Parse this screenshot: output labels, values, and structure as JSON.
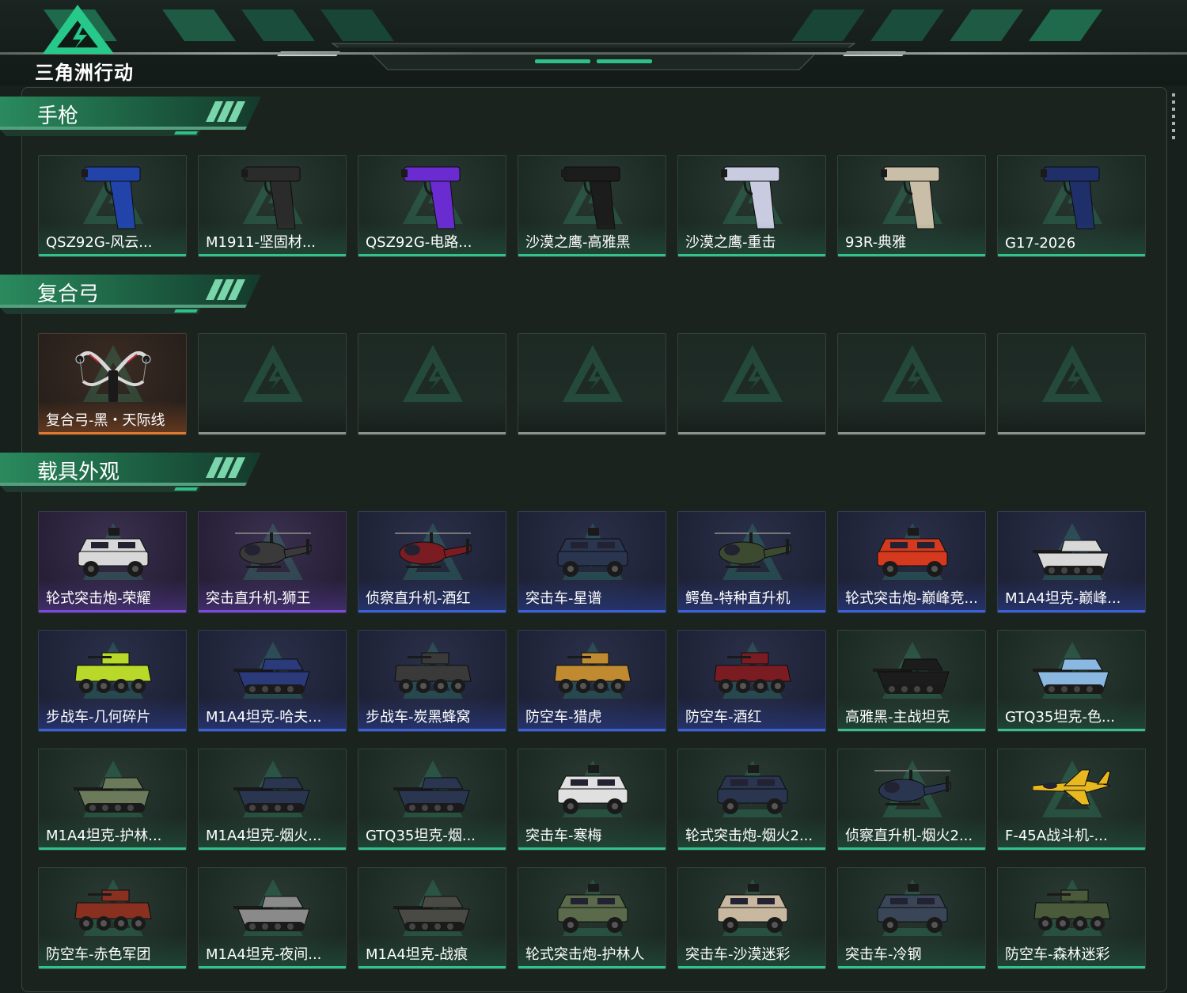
{
  "app": {
    "logo_text": "三角洲行动"
  },
  "sections": {
    "pistols": {
      "title": "手枪",
      "items": [
        {
          "label": "QSZ92G-风云...",
          "rarity": "green",
          "icon": "pistol-icon",
          "color": "#2244aa"
        },
        {
          "label": "M1911-坚固材...",
          "rarity": "green",
          "icon": "pistol-icon",
          "color": "#2b2b2b"
        },
        {
          "label": "QSZ92G-电路...",
          "rarity": "green",
          "icon": "pistol-icon",
          "color": "#6a2bd0"
        },
        {
          "label": "沙漠之鹰-高雅黑",
          "rarity": "green",
          "icon": "pistol-icon",
          "color": "#1c1c1c"
        },
        {
          "label": "沙漠之鹰-重击",
          "rarity": "green",
          "icon": "pistol-icon",
          "color": "#c9cbe0"
        },
        {
          "label": "93R-典雅",
          "rarity": "green",
          "icon": "pistol-icon",
          "color": "#c9bfa8"
        },
        {
          "label": "G17-2026",
          "rarity": "green",
          "icon": "pistol-icon",
          "color": "#1f2f6a"
        }
      ]
    },
    "bows": {
      "title": "复合弓",
      "items": [
        {
          "label": "复合弓-黑・天际线",
          "rarity": "orange",
          "icon": "bow-icon",
          "color": "#d8d8d8"
        },
        {
          "label": "",
          "rarity": "empty",
          "icon": "",
          "color": ""
        },
        {
          "label": "",
          "rarity": "empty",
          "icon": "",
          "color": ""
        },
        {
          "label": "",
          "rarity": "empty",
          "icon": "",
          "color": ""
        },
        {
          "label": "",
          "rarity": "empty",
          "icon": "",
          "color": ""
        },
        {
          "label": "",
          "rarity": "empty",
          "icon": "",
          "color": ""
        },
        {
          "label": "",
          "rarity": "empty",
          "icon": "",
          "color": ""
        }
      ]
    },
    "vehicles": {
      "title": "载具外观",
      "items": [
        {
          "label": "轮式突击炮-荣耀",
          "rarity": "purple",
          "icon": "armored-car-icon",
          "color": "#d8d8d8"
        },
        {
          "label": "突击直升机-狮王",
          "rarity": "purple",
          "icon": "helicopter-icon",
          "color": "#3a3a3a"
        },
        {
          "label": "侦察直升机-酒红",
          "rarity": "blue",
          "icon": "helicopter-icon",
          "color": "#7a1c22"
        },
        {
          "label": "突击车-星谱",
          "rarity": "blue",
          "icon": "armored-car-icon",
          "color": "#2a3550"
        },
        {
          "label": "鳄鱼-特种直升机",
          "rarity": "blue",
          "icon": "helicopter-icon",
          "color": "#3c4a30"
        },
        {
          "label": "轮式突击炮-巅峰竞...",
          "rarity": "blue",
          "icon": "armored-car-icon",
          "color": "#d63a1e"
        },
        {
          "label": "M1A4坦克-巅峰...",
          "rarity": "blue",
          "icon": "tank-icon",
          "color": "#d8d8d8"
        },
        {
          "label": "步战车-几何碎片",
          "rarity": "blue",
          "icon": "apc-icon",
          "color": "#b8d82a"
        },
        {
          "label": "M1A4坦克-哈夫...",
          "rarity": "blue",
          "icon": "tank-icon",
          "color": "#2a3a7a"
        },
        {
          "label": "步战车-炭黑蜂窝",
          "rarity": "blue",
          "icon": "apc-icon",
          "color": "#3a3a3a"
        },
        {
          "label": "防空车-猎虎",
          "rarity": "blue",
          "icon": "apc-icon",
          "color": "#c08a30"
        },
        {
          "label": "防空车-酒红",
          "rarity": "blue",
          "icon": "apc-icon",
          "color": "#7a1c22"
        },
        {
          "label": "高雅黑-主战坦克",
          "rarity": "green",
          "icon": "tank-icon",
          "color": "#1c1c1c"
        },
        {
          "label": "GTQ35坦克-色...",
          "rarity": "green",
          "icon": "tank-icon",
          "color": "#8ab8e0"
        },
        {
          "label": "M1A4坦克-护林...",
          "rarity": "green",
          "icon": "tank-icon",
          "color": "#6a7a5a"
        },
        {
          "label": "M1A4坦克-烟火...",
          "rarity": "green",
          "icon": "tank-icon",
          "color": "#2a3550"
        },
        {
          "label": "GTQ35坦克-烟...",
          "rarity": "green",
          "icon": "tank-icon",
          "color": "#2a3550"
        },
        {
          "label": "突击车-寒梅",
          "rarity": "green",
          "icon": "armored-car-icon",
          "color": "#e0e0e0"
        },
        {
          "label": "轮式突击炮-烟火2...",
          "rarity": "green",
          "icon": "armored-car-icon",
          "color": "#2a3550"
        },
        {
          "label": "侦察直升机-烟火2...",
          "rarity": "green",
          "icon": "helicopter-icon",
          "color": "#2a3550"
        },
        {
          "label": "F-45A战斗机-...",
          "rarity": "green",
          "icon": "jet-icon",
          "color": "#e8b820"
        },
        {
          "label": "防空车-赤色军团",
          "rarity": "green",
          "icon": "apc-icon",
          "color": "#8a3020"
        },
        {
          "label": "M1A4坦克-夜间...",
          "rarity": "green",
          "icon": "tank-icon",
          "color": "#8a8a8a"
        },
        {
          "label": "M1A4坦克-战痕",
          "rarity": "green",
          "icon": "tank-icon",
          "color": "#4a4a44"
        },
        {
          "label": "轮式突击炮-护林人",
          "rarity": "green",
          "icon": "armored-car-icon",
          "color": "#5a6a4a"
        },
        {
          "label": "突击车-沙漠迷彩",
          "rarity": "green",
          "icon": "armored-car-icon",
          "color": "#c8b8a0"
        },
        {
          "label": "突击车-冷钢",
          "rarity": "green",
          "icon": "armored-car-icon",
          "color": "#3a4658"
        },
        {
          "label": "防空车-森林迷彩",
          "rarity": "green",
          "icon": "apc-icon",
          "color": "#4a5a3a"
        }
      ]
    }
  },
  "colors": {
    "accent": "#2fc08a",
    "rarity_green": "#32c28a",
    "rarity_purple": "#7b4ad8",
    "rarity_blue": "#3a62d6",
    "rarity_orange": "#e07a2e"
  }
}
